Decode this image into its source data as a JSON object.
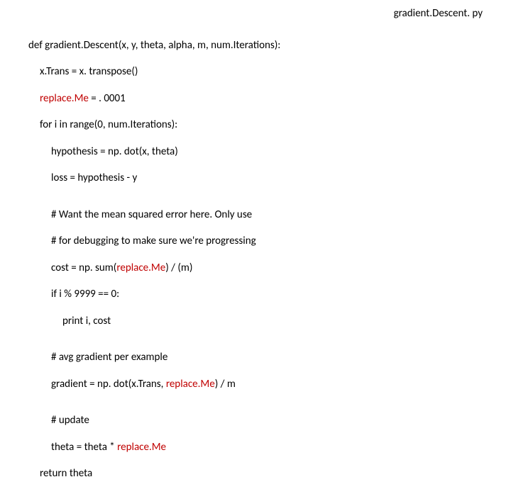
{
  "title": "gradient.Descent. py",
  "code": {
    "l1": "def gradient.Descent(x, y, theta, alpha, m, num.Iterations):",
    "l2": "x.Trans = x. transpose()",
    "l3a": "replace.Me",
    "l3b": " = . 0001",
    "l4": "for i in range(0, num.Iterations):",
    "l5": "hypothesis = np. dot(x, theta)",
    "l6": "loss = hypothesis - y",
    "l7": "# Want the mean squared error here. Only use",
    "l8": "# for debugging to make sure we're progressing",
    "l9a": "cost = np. sum(",
    "l9b": "replace.Me",
    "l9c": ") / (m)",
    "l10": "if i % 9999 == 0:",
    "l11": "print i, cost",
    "l12": "# avg gradient per example",
    "l13a": "gradient = np. dot(x.Trans, ",
    "l13b": "replace.Me",
    "l13c": ") / m",
    "l14": "# update",
    "l15a": "theta = theta * ",
    "l15b": "replace.Me",
    "l16": "return theta"
  }
}
